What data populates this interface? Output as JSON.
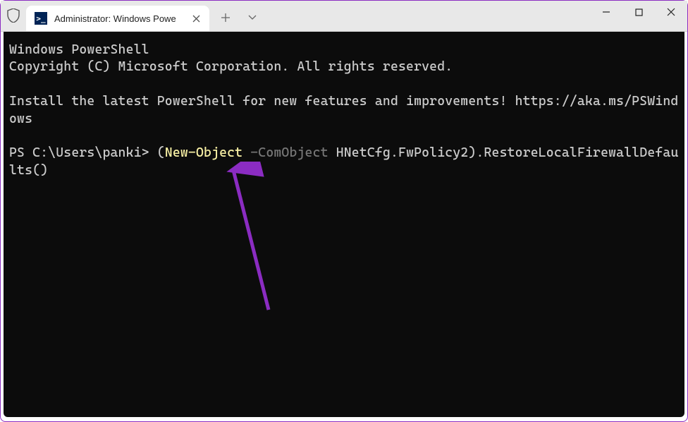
{
  "titlebar": {
    "tab_title": "Administrator: Windows Powe",
    "ps_icon_glyph": ">_"
  },
  "terminal": {
    "header_line1": "Windows PowerShell",
    "header_line2": "Copyright (C) Microsoft Corporation. All rights reserved.",
    "install_msg": "Install the latest PowerShell for new features and improvements! https://aka.ms/PSWindows",
    "prompt": "PS C:\\Users\\panki> ",
    "cmd_paren_open": "(",
    "cmd_cmdlet": "New-Object",
    "cmd_space1": " ",
    "cmd_param": "-ComObject",
    "cmd_space2": " ",
    "cmd_arg": "HNetCfg.FwPolicy2",
    "cmd_paren_close": ")",
    "cmd_method": ".RestoreLocalFirewallDefaults()"
  },
  "colors": {
    "accent_arrow": "#8b2cc2"
  }
}
